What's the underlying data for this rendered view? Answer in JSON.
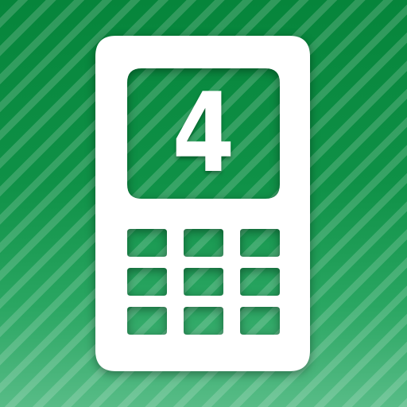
{
  "icon": {
    "display_number": "4",
    "colors": {
      "background_top": "#06853b",
      "background_bottom": "#58bc87",
      "phone_body": "#ffffff",
      "digit": "#ffffff"
    },
    "icons": {
      "phone": "mobile-phone-icon"
    }
  }
}
